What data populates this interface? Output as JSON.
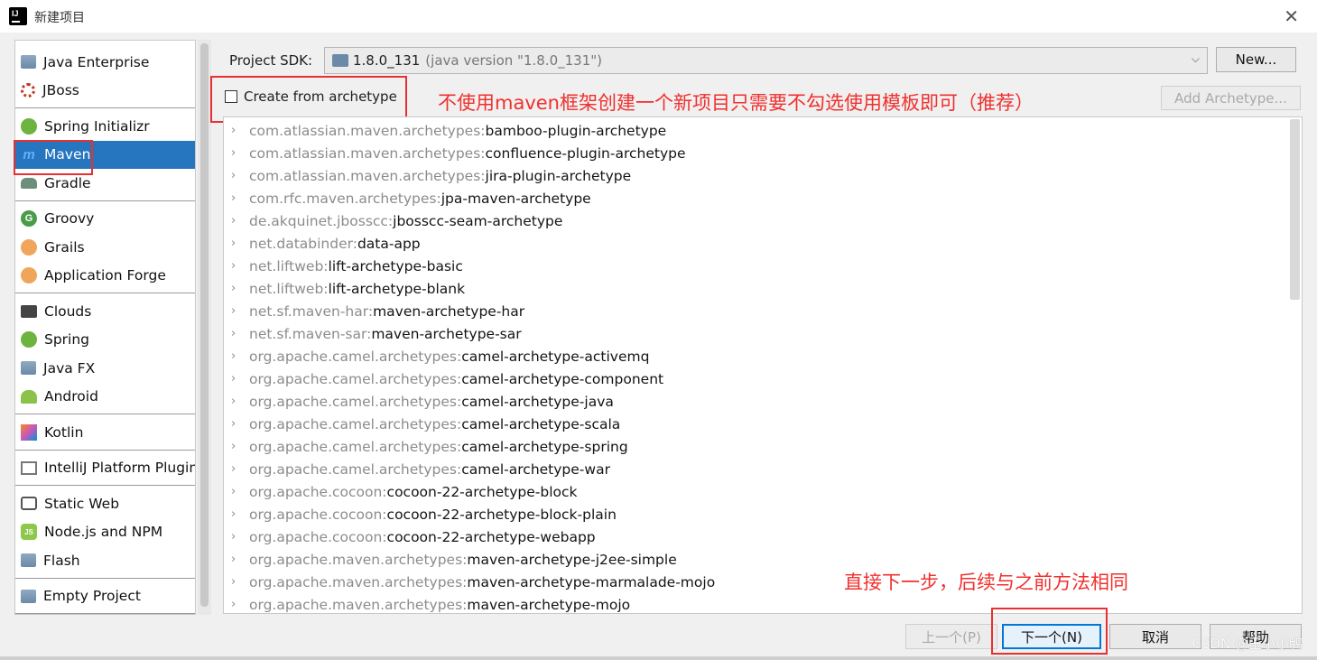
{
  "window": {
    "title": "新建项目",
    "close_glyph": "✕",
    "app_icon_letters": "IJ"
  },
  "sidebar": {
    "groups": [
      [
        {
          "label": "Java Enterprise",
          "icon": "java-enterprise-icon"
        },
        {
          "label": "JBoss",
          "icon": "jboss-icon"
        }
      ],
      [
        {
          "label": "Spring Initializr",
          "icon": "spring-initializr-icon"
        },
        {
          "label": "Maven",
          "icon": "maven-icon",
          "selected": true
        },
        {
          "label": "Gradle",
          "icon": "gradle-icon"
        }
      ],
      [
        {
          "label": "Groovy",
          "icon": "groovy-icon"
        },
        {
          "label": "Grails",
          "icon": "grails-icon"
        },
        {
          "label": "Application Forge",
          "icon": "application-forge-icon"
        }
      ],
      [
        {
          "label": "Clouds",
          "icon": "clouds-icon"
        },
        {
          "label": "Spring",
          "icon": "spring-icon"
        },
        {
          "label": "Java FX",
          "icon": "javafx-icon"
        },
        {
          "label": "Android",
          "icon": "android-icon"
        }
      ],
      [
        {
          "label": "Kotlin",
          "icon": "kotlin-icon"
        }
      ],
      [
        {
          "label": "IntelliJ Platform Plugin",
          "icon": "intellij-plugin-icon"
        }
      ],
      [
        {
          "label": "Static Web",
          "icon": "static-web-icon"
        },
        {
          "label": "Node.js and NPM",
          "icon": "nodejs-icon"
        },
        {
          "label": "Flash",
          "icon": "flash-icon"
        }
      ],
      [
        {
          "label": "Empty Project",
          "icon": "empty-project-icon"
        }
      ]
    ]
  },
  "sdk": {
    "label": "Project SDK:",
    "value": "1.8.0_131",
    "detail": "(java version \"1.8.0_131\")",
    "new_button": "New..."
  },
  "archetype": {
    "checkbox_label": "Create from archetype",
    "checked": false,
    "add_button": "Add Archetype...",
    "items": [
      {
        "group": "com.atlassian.maven.archetypes:",
        "artifact": "bamboo-plugin-archetype"
      },
      {
        "group": "com.atlassian.maven.archetypes:",
        "artifact": "confluence-plugin-archetype"
      },
      {
        "group": "com.atlassian.maven.archetypes:",
        "artifact": "jira-plugin-archetype"
      },
      {
        "group": "com.rfc.maven.archetypes:",
        "artifact": "jpa-maven-archetype"
      },
      {
        "group": "de.akquinet.jbosscc:",
        "artifact": "jbosscc-seam-archetype"
      },
      {
        "group": "net.databinder:",
        "artifact": "data-app"
      },
      {
        "group": "net.liftweb:",
        "artifact": "lift-archetype-basic"
      },
      {
        "group": "net.liftweb:",
        "artifact": "lift-archetype-blank"
      },
      {
        "group": "net.sf.maven-har:",
        "artifact": "maven-archetype-har"
      },
      {
        "group": "net.sf.maven-sar:",
        "artifact": "maven-archetype-sar"
      },
      {
        "group": "org.apache.camel.archetypes:",
        "artifact": "camel-archetype-activemq"
      },
      {
        "group": "org.apache.camel.archetypes:",
        "artifact": "camel-archetype-component"
      },
      {
        "group": "org.apache.camel.archetypes:",
        "artifact": "camel-archetype-java"
      },
      {
        "group": "org.apache.camel.archetypes:",
        "artifact": "camel-archetype-scala"
      },
      {
        "group": "org.apache.camel.archetypes:",
        "artifact": "camel-archetype-spring"
      },
      {
        "group": "org.apache.camel.archetypes:",
        "artifact": "camel-archetype-war"
      },
      {
        "group": "org.apache.cocoon:",
        "artifact": "cocoon-22-archetype-block"
      },
      {
        "group": "org.apache.cocoon:",
        "artifact": "cocoon-22-archetype-block-plain"
      },
      {
        "group": "org.apache.cocoon:",
        "artifact": "cocoon-22-archetype-webapp"
      },
      {
        "group": "org.apache.maven.archetypes:",
        "artifact": "maven-archetype-j2ee-simple"
      },
      {
        "group": "org.apache.maven.archetypes:",
        "artifact": "maven-archetype-marmalade-mojo"
      },
      {
        "group": "org.apache.maven.archetypes:",
        "artifact": "maven-archetype-mojo"
      }
    ]
  },
  "annotations": {
    "top_note": "不使用maven框架创建一个新项目只需要不勾选使用模板即可（推荐）",
    "bottom_note": "直接下一步，后续与之前方法相同"
  },
  "footer": {
    "prev_button": "上一个(P)",
    "next_button": "下一个(N)",
    "cancel_button": "取消",
    "help_button": "帮助"
  },
  "watermark": "CSDN @王小小鸭",
  "colors": {
    "selection": "#2675bf",
    "annotation_red": "#f0302e"
  }
}
